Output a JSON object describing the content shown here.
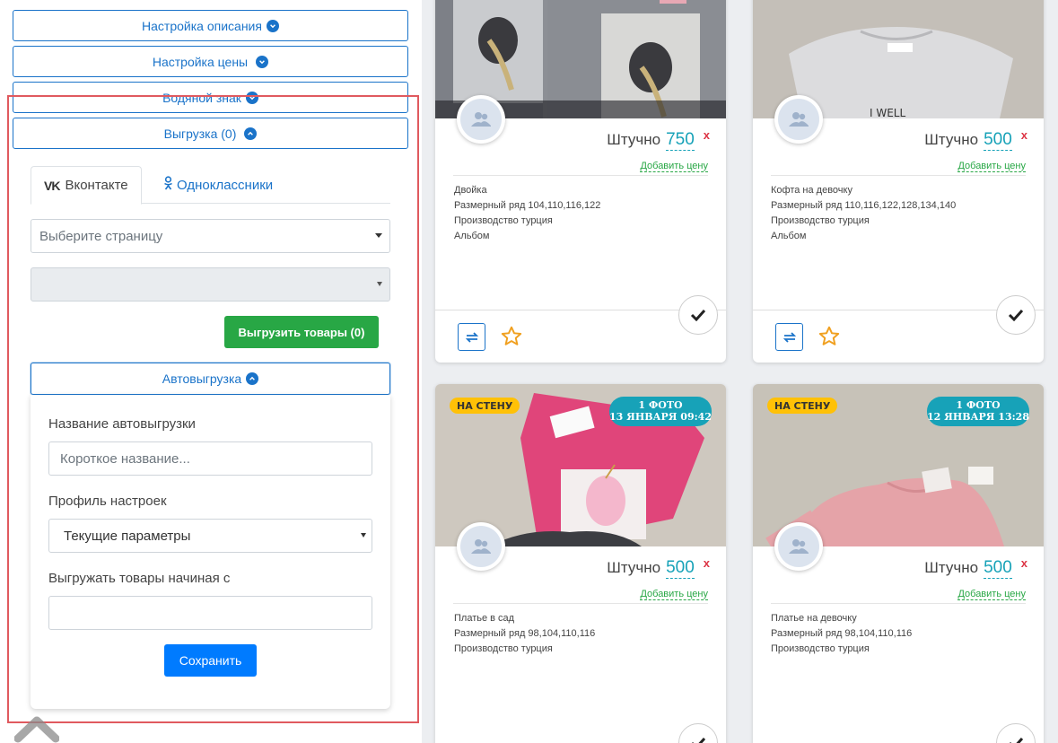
{
  "left_panel": {
    "accordions": {
      "description": "Настройка описания",
      "price": "Настройка цены",
      "watermark": "Водяной знак",
      "export": "Выгрузка (0)"
    },
    "tabs": {
      "vk": "Вконтакте",
      "ok": "Одноклассники"
    },
    "page_select_placeholder": "Выберите страницу",
    "export_button": "Выгрузить товары (0)",
    "autoexport": {
      "header": "Автовыгрузка",
      "name_label": "Название автовыгрузки",
      "name_placeholder": "Короткое название...",
      "profile_label": "Профиль настроек",
      "profile_value": "Текущие параметры",
      "start_label": "Выгружать товары начиная с",
      "start_value": "",
      "save_button": "Сохранить"
    }
  },
  "colors": {
    "accent": "#1a73c9",
    "price": "#17a2b8",
    "green": "#28a745",
    "badge_wall": "#ffc107",
    "highlight_frame": "#e05a5f"
  },
  "cards": [
    {
      "unit": "Штучно",
      "price": "750",
      "remove": "x",
      "add_price": "Добавить цену",
      "lines": [
        "Двойка",
        "Размерный ряд 104,110,116,122",
        "Производство турция",
        "Альбом"
      ]
    },
    {
      "unit": "Штучно",
      "price": "500",
      "remove": "x",
      "add_price": "Добавить цену",
      "lines": [
        "Кофта на девочку",
        "Размерный ряд 110,116,122,128,134,140",
        "Производство турция",
        "Альбом"
      ]
    },
    {
      "wall_badge": "НА СТЕНУ",
      "photo_badge_1": "1 ФОТО",
      "photo_badge_2": "13 ЯНВАРЯ 09:42",
      "unit": "Штучно",
      "price": "500",
      "remove": "x",
      "add_price": "Добавить цену",
      "lines": [
        "Платье в сад",
        "Размерный ряд 98,104,110,116",
        "Производство турция"
      ]
    },
    {
      "wall_badge": "НА СТЕНУ",
      "photo_badge_1": "1 ФОТО",
      "photo_badge_2": "12 ЯНВАРЯ 13:28",
      "unit": "Штучно",
      "price": "500",
      "remove": "x",
      "add_price": "Добавить цену",
      "lines": [
        "Платье на девочку",
        "Размерный ряд 98,104,110,116",
        "Производство турция"
      ]
    }
  ],
  "icons": [
    "chevron-down-icon",
    "chevron-up-icon",
    "vk-icon",
    "ok-icon",
    "users-icon",
    "check-icon",
    "swap-icon",
    "star-icon",
    "scroll-up-icon"
  ]
}
